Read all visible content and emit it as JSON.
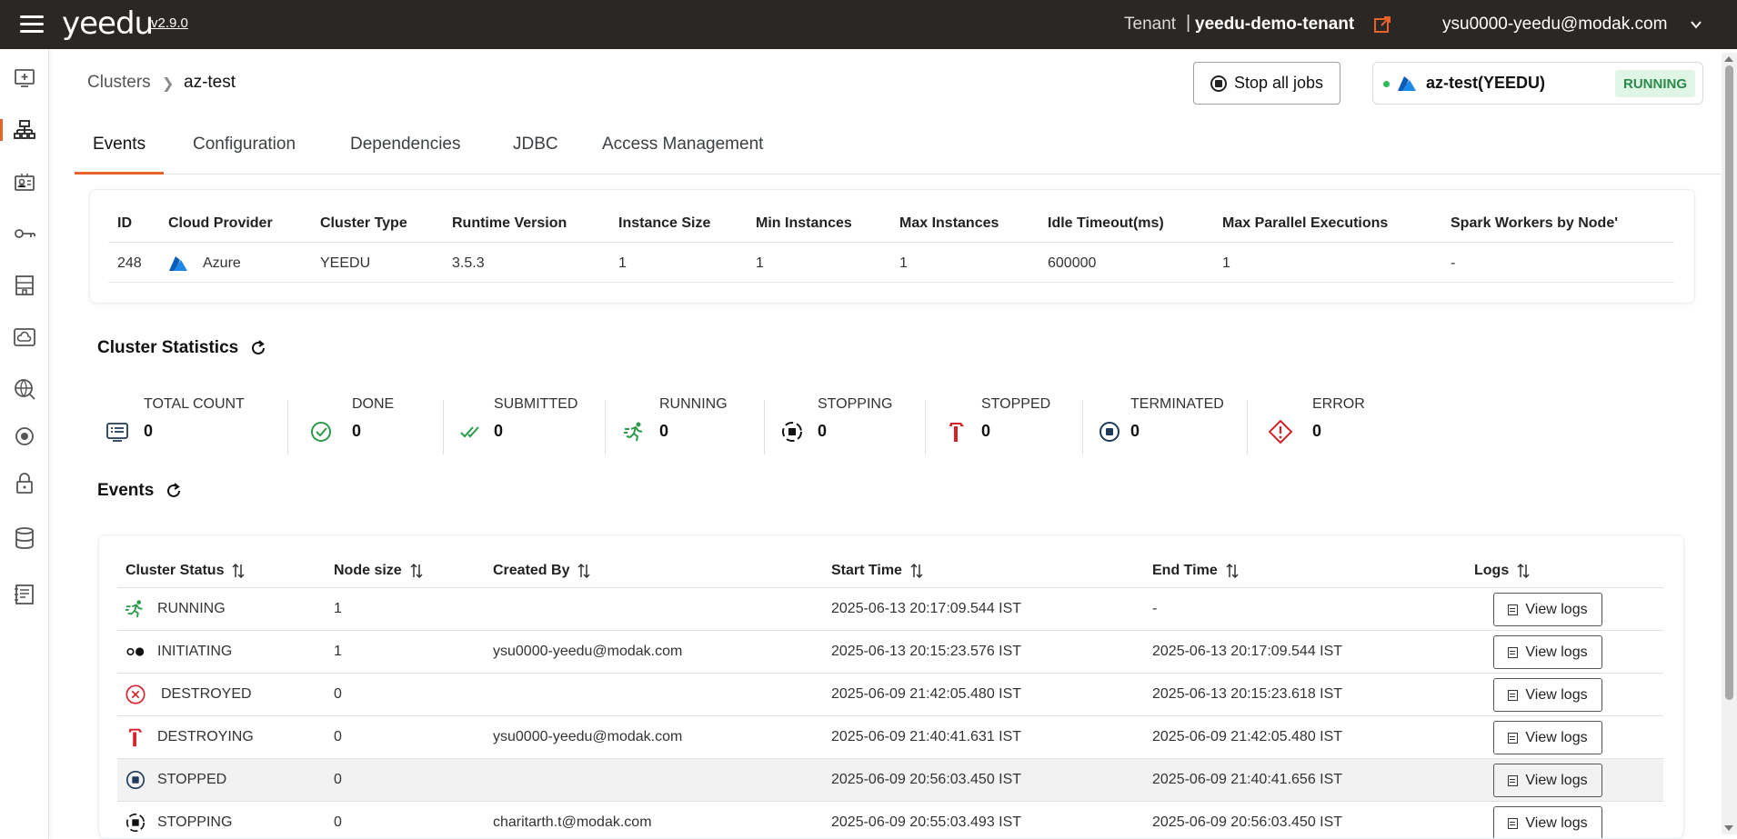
{
  "app": {
    "logo": "yeedu",
    "version": "v2.9.0"
  },
  "header": {
    "tenant_label": "Tenant",
    "tenant_sep": "|",
    "tenant_name": "yeedu-demo-tenant",
    "user_email": "ysu0000-yeedu@modak.com"
  },
  "sidebar": {
    "items": [
      {
        "icon": "add-screen-icon"
      },
      {
        "icon": "cluster-icon",
        "active": true
      },
      {
        "icon": "id-card-icon"
      },
      {
        "icon": "key-icon"
      },
      {
        "icon": "building-icon"
      },
      {
        "icon": "cloud-icon"
      },
      {
        "icon": "globe-icon"
      },
      {
        "icon": "target-icon"
      },
      {
        "icon": "lock-icon"
      },
      {
        "icon": "database-icon"
      },
      {
        "icon": "notes-icon"
      }
    ]
  },
  "breadcrumb": {
    "root": "Clusters",
    "current": "az-test"
  },
  "actions": {
    "stop_all_jobs": "Stop all jobs"
  },
  "cluster_badge": {
    "name": "az-test(YEEDU)",
    "status": "RUNNING",
    "status_color": "#2b8a4a"
  },
  "tabs": [
    "Events",
    "Configuration",
    "Dependencies",
    "JDBC",
    "Access Management"
  ],
  "info": {
    "headers": [
      "ID",
      "Cloud Provider",
      "Cluster Type",
      "Runtime Version",
      "Instance Size",
      "Min Instances",
      "Max Instances",
      "Idle Timeout(ms)",
      "Max Parallel Executions",
      "Spark Workers by Node'"
    ],
    "row": [
      "248",
      "Azure",
      "YEEDU",
      "3.5.3",
      "1",
      "1",
      "1",
      "600000",
      "1",
      "-"
    ]
  },
  "statistics": {
    "title": "Cluster Statistics",
    "items": [
      {
        "label": "TOTAL COUNT",
        "value": "0",
        "icon": "list-icon"
      },
      {
        "label": "DONE",
        "value": "0",
        "icon": "check-circle-icon"
      },
      {
        "label": "SUBMITTED",
        "value": "0",
        "icon": "double-check-icon"
      },
      {
        "label": "RUNNING",
        "value": "0",
        "icon": "running-icon"
      },
      {
        "label": "STOPPING",
        "value": "0",
        "icon": "stopping-icon"
      },
      {
        "label": "STOPPED",
        "value": "0",
        "icon": "hammer-icon"
      },
      {
        "label": "TERMINATED",
        "value": "0",
        "icon": "stop-circle-icon"
      },
      {
        "label": "ERROR",
        "value": "0",
        "icon": "error-diamond-icon"
      }
    ]
  },
  "events": {
    "title": "Events",
    "headers": [
      "Cluster Status",
      "Node size",
      "Created By",
      "Start Time",
      "End Time",
      "Logs"
    ],
    "view_logs_label": "View logs",
    "rows": [
      {
        "status": "RUNNING",
        "icon": "running-icon",
        "node_size": "1",
        "created_by": "",
        "start": "2025-06-13 20:17:09.544 IST",
        "end": "-"
      },
      {
        "status": "INITIATING",
        "icon": "initiating-icon",
        "node_size": "1",
        "created_by": "ysu0000-yeedu@modak.com",
        "start": "2025-06-13 20:15:23.576 IST",
        "end": "2025-06-13 20:17:09.544 IST"
      },
      {
        "status": "DESTROYED",
        "icon": "x-circle-icon",
        "node_size": "0",
        "created_by": "",
        "start": "2025-06-09 21:42:05.480 IST",
        "end": "2025-06-13 20:15:23.618 IST"
      },
      {
        "status": "DESTROYING",
        "icon": "hammer-icon",
        "node_size": "0",
        "created_by": "ysu0000-yeedu@modak.com",
        "start": "2025-06-09 21:40:41.631 IST",
        "end": "2025-06-09 21:42:05.480 IST"
      },
      {
        "status": "STOPPED",
        "icon": "stop-circle-icon",
        "node_size": "0",
        "created_by": "",
        "start": "2025-06-09 20:56:03.450 IST",
        "end": "2025-06-09 21:40:41.656 IST"
      },
      {
        "status": "STOPPING",
        "icon": "stopping-icon",
        "node_size": "0",
        "created_by": "charitarth.t@modak.com",
        "start": "2025-06-09 20:55:03.493 IST",
        "end": "2025-06-09 20:56:03.450 IST"
      }
    ]
  }
}
